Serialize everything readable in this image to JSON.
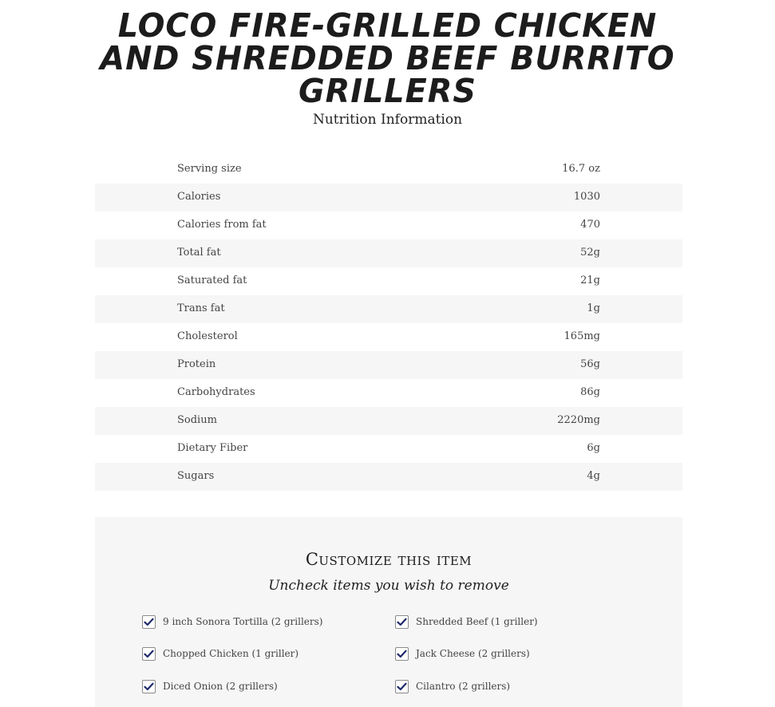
{
  "product": {
    "title_line1": "LOCO FIRE-GRILLED CHICKEN",
    "title_line2": "AND SHREDDED BEEF BURRITO",
    "title_line3": "GRILLERS",
    "subtitle": "Nutrition Information"
  },
  "nutrition": [
    {
      "label": "Serving size",
      "value": "16.7 oz"
    },
    {
      "label": "Calories",
      "value": "1030"
    },
    {
      "label": "Calories from fat",
      "value": "470"
    },
    {
      "label": "Total fat",
      "value": "52g"
    },
    {
      "label": "Saturated fat",
      "value": "21g"
    },
    {
      "label": "Trans fat",
      "value": "1g"
    },
    {
      "label": "Cholesterol",
      "value": "165mg"
    },
    {
      "label": "Protein",
      "value": "56g"
    },
    {
      "label": "Carbohydrates",
      "value": "86g"
    },
    {
      "label": "Sodium",
      "value": "2220mg"
    },
    {
      "label": "Dietary Fiber",
      "value": "6g"
    },
    {
      "label": "Sugars",
      "value": "4g"
    }
  ],
  "customize": {
    "heading": "Customize this item",
    "instruction": "Uncheck items you wish to remove",
    "options": [
      {
        "label": "9 inch Sonora Tortilla (2 grillers)",
        "checked": true
      },
      {
        "label": "Shredded Beef (1 griller)",
        "checked": true
      },
      {
        "label": "Chopped Chicken (1 griller)",
        "checked": true
      },
      {
        "label": "Jack Cheese (2 grillers)",
        "checked": true
      },
      {
        "label": "Diced Onion (2 grillers)",
        "checked": true
      },
      {
        "label": "Cilantro (2 grillers)",
        "checked": true
      }
    ]
  },
  "colors": {
    "checkmark": "#1f2a6b",
    "panel_background": "#f6f6f6"
  }
}
